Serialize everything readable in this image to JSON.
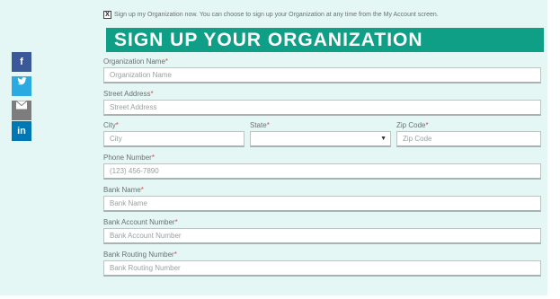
{
  "signup_toggle": {
    "mark": "X",
    "text": "Sign up my Organization now. You can choose to sign up your Organization at any time from the My Account screen."
  },
  "banner": {
    "title": "SIGN UP YOUR ORGANIZATION"
  },
  "required_mark": "*",
  "fields": {
    "org_name": {
      "label": "Organization Name",
      "placeholder": "Organization Name"
    },
    "street": {
      "label": "Street Address",
      "placeholder": "Street Address"
    },
    "city": {
      "label": "City",
      "placeholder": "City"
    },
    "state": {
      "label": "State",
      "value": ""
    },
    "zip": {
      "label": "Zip Code",
      "placeholder": "Zip Code"
    },
    "phone": {
      "label": "Phone Number",
      "placeholder": "(123) 456-7890"
    },
    "bank_name": {
      "label": "Bank Name",
      "placeholder": "Bank Name"
    },
    "bank_account": {
      "label": "Bank Account Number",
      "placeholder": "Bank Account Number"
    },
    "bank_routing": {
      "label": "Bank Routing Number",
      "placeholder": "Bank Routing Number"
    }
  },
  "share": {
    "facebook": {
      "icon": "facebook-icon",
      "glyph": "f",
      "color": "#3b5998"
    },
    "twitter": {
      "icon": "twitter-icon",
      "color": "#2ba9e1"
    },
    "email": {
      "icon": "email-icon",
      "color": "#7d7d7d"
    },
    "linkedin": {
      "icon": "linkedin-icon",
      "glyph": "in",
      "color": "#0077b5"
    }
  },
  "colors": {
    "banner": "#0f9e86",
    "background": "#e4f7f5",
    "required": "#e14b4b"
  }
}
